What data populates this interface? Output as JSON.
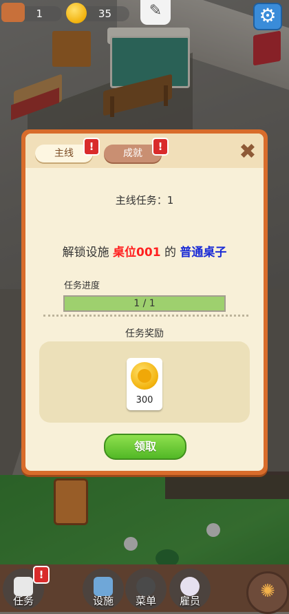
{
  "hud": {
    "chest_count": "1",
    "coin_count": "35",
    "chest_icon": "treasure-chest-icon",
    "coin_icon": "coin-icon",
    "settings_icon": "gear-icon"
  },
  "dialog": {
    "tabs": [
      {
        "label": "主线",
        "badge": "!"
      },
      {
        "label": "成就",
        "badge": "!"
      }
    ],
    "close_icon": "close-icon",
    "task_number": "主线任务：1",
    "task_desc_prefix": "解锁设施",
    "task_desc_target": "桌位001",
    "task_desc_middle": "的",
    "task_desc_item": "普通桌子",
    "progress_label": "任务进度",
    "progress_text": "1 / 1",
    "progress_value": 1.0,
    "reward_title": "任务奖励",
    "reward_amount": "300",
    "claim_label": "领取"
  },
  "nav": {
    "items": [
      {
        "label": "任务",
        "badge": "!"
      },
      {
        "label": "设施"
      },
      {
        "label": "菜单"
      },
      {
        "label": "雇员"
      }
    ]
  },
  "colors": {
    "dialog_border": "#d86c2b",
    "dialog_bg": "#f8f0d8",
    "highlight_red": "#ff1f1f",
    "highlight_blue": "#1a2bd6",
    "progress_fill": "#9ed06e",
    "claim_button": "#52b826"
  }
}
